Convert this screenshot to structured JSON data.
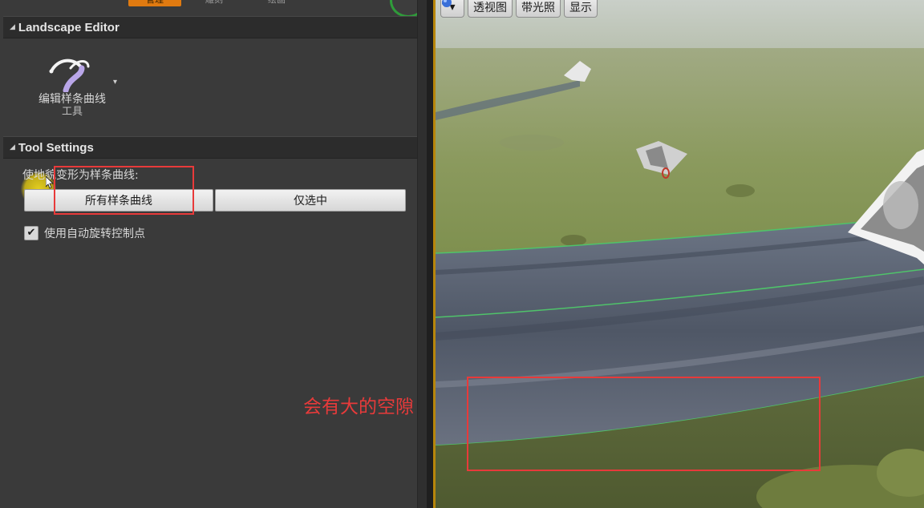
{
  "top_tabs": {
    "tab1": "管理",
    "tab2": "雕刻",
    "tab3": "绘画"
  },
  "landscape_section": {
    "title": "Landscape Editor"
  },
  "tool": {
    "name": "编辑样条曲线",
    "suffix": "工具",
    "dropdown_glyph": "▾"
  },
  "tool_settings": {
    "title": "Tool Settings",
    "deform_label": "使地貌变形为样条曲线:",
    "all_splines_button": "所有样条曲线",
    "selected_only_button": "仅选中",
    "auto_rotate_label": "使用自动旋转控制点",
    "auto_rotate_checked": true
  },
  "viewport_toolbar": {
    "dropdown_glyph": "▾",
    "perspective_label": "透视图",
    "lit_label": "带光照",
    "show_label": "显示"
  },
  "annotation": {
    "text": "会有大的空隙",
    "color": "#e83a3a"
  },
  "colors": {
    "accent_orange": "#e07a10",
    "annotation_red": "#e83a3a",
    "divider_gold": "#b8860b"
  }
}
